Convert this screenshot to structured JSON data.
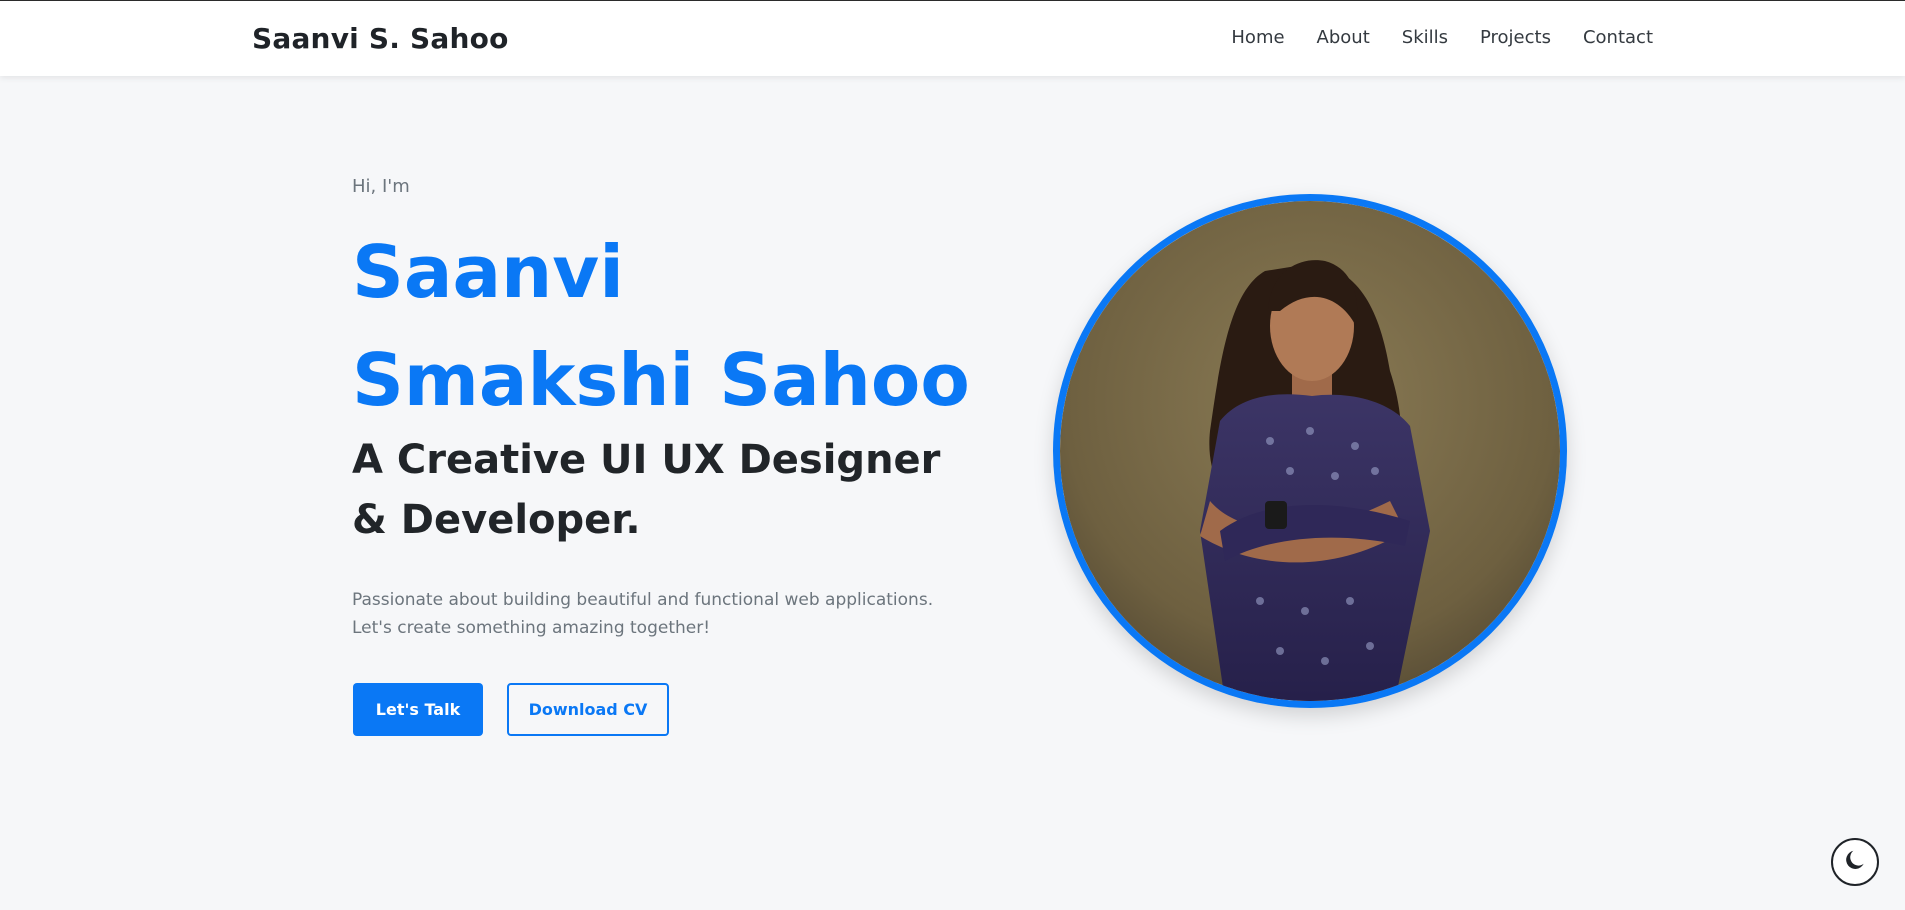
{
  "header": {
    "brand": "Saanvi S. Sahoo",
    "nav": [
      "Home",
      "About",
      "Skills",
      "Projects",
      "Contact"
    ]
  },
  "hero": {
    "greeting": "Hi, I'm",
    "name": "Saanvi Smakshi Sahoo",
    "role": "A Creative UI UX Designer & Developer.",
    "description": "Passionate about building beautiful and functional web applications. Let's create something amazing together!",
    "primary_button": "Let's Talk",
    "secondary_button": "Download CV"
  },
  "icons": {
    "theme_toggle": "moon-icon"
  },
  "colors": {
    "accent": "#0a78f5",
    "background": "#f6f7f9",
    "heading": "#212529",
    "muted": "#6c757d"
  }
}
